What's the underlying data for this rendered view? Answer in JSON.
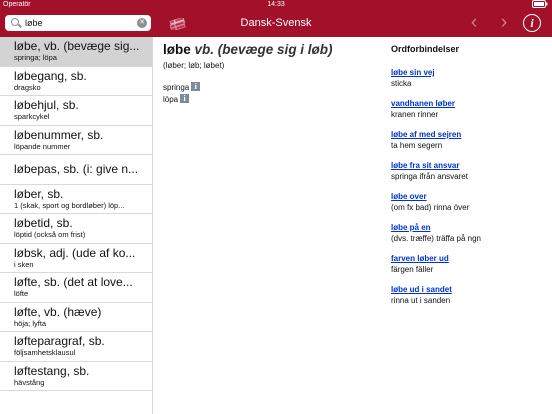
{
  "status": {
    "carrier": "Operatör",
    "time": "14:33",
    "battery_icon": "battery-icon"
  },
  "topbar": {
    "search_value": "løbe",
    "title": "Dansk-Svensk",
    "back_icon": "chevron-left-icon",
    "forward_icon": "chevron-right-icon",
    "info_label": "i",
    "accent": "#a3102a"
  },
  "list": {
    "items": [
      {
        "headword": "løbe, vb. (bevæge sig...",
        "translation": "springa; löpa",
        "selected": true
      },
      {
        "headword": "løbegang, sb.",
        "translation": "dragsko"
      },
      {
        "headword": "løbehjul, sb.",
        "translation": "sparkcykel"
      },
      {
        "headword": "løbenummer, sb.",
        "translation": "löpande nummer"
      },
      {
        "headword": "løbepas, sb. (i: give n...",
        "translation": ""
      },
      {
        "headword": "løber, sb.",
        "translation": "1 (skak, sport og bordløber) löp..."
      },
      {
        "headword": "løbetid, sb.",
        "translation": "löptid (också om frist)"
      },
      {
        "headword": "løbsk, adj. (ude af ko...",
        "translation": "i sken"
      },
      {
        "headword": "løfte, sb. (det at love...",
        "translation": "löfte"
      },
      {
        "headword": "løfte, vb. (hæve)",
        "translation": "höja; lyfta"
      },
      {
        "headword": "løfteparagraf, sb.",
        "translation": "följsamhetsklausul"
      },
      {
        "headword": "løftestang, sb.",
        "translation": "hävstång"
      }
    ]
  },
  "entry": {
    "headword": "løbe",
    "grammar": "vb. (bevæge sig i løb)",
    "forms": "(løber; løb; løbet)",
    "translations": [
      {
        "text": "springa",
        "icon": "info-icon",
        "icon_label": "i"
      },
      {
        "text": "löpa",
        "icon": "info-icon",
        "icon_label": "i"
      }
    ]
  },
  "phrases": {
    "heading": "Ordforbindelser",
    "items": [
      {
        "da": "løbe sin vej",
        "sv": "sticka"
      },
      {
        "da": "vandhanen løber",
        "sv": "kranen rinner"
      },
      {
        "da": "løbe af med sejren",
        "sv": "ta hem segern"
      },
      {
        "da": "løbe fra sit ansvar",
        "sv": "springa ifrån ansvaret"
      },
      {
        "da": "løbe over",
        "sv": "(om fx bad) rinna över"
      },
      {
        "da": "løbe på en",
        "sv": "(dvs. træffe) träffa på ngn"
      },
      {
        "da": "farven løber ud",
        "sv": "färgen fäller"
      },
      {
        "da": "løbe ud i sandet",
        "sv": "rinna ut i sanden"
      }
    ]
  }
}
